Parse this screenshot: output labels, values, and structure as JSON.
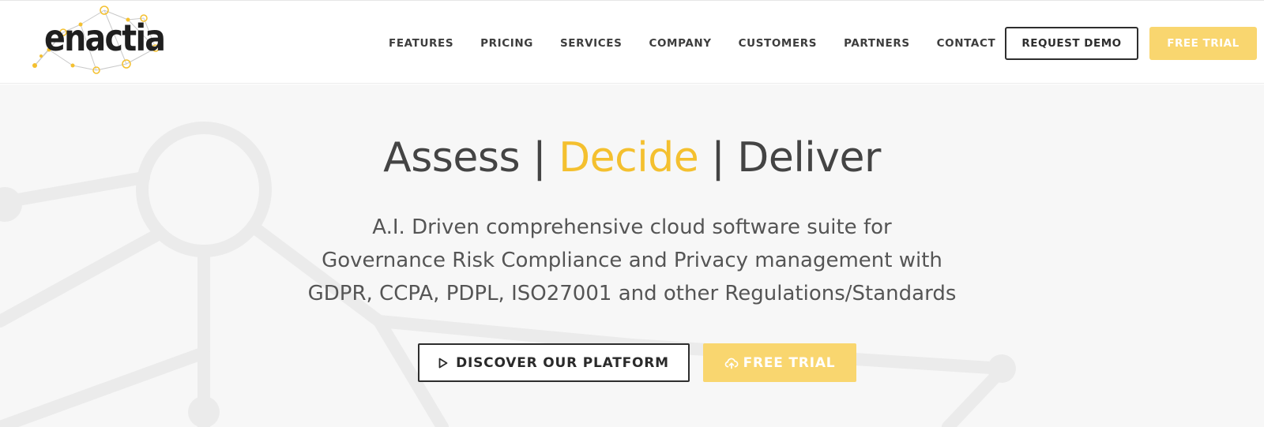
{
  "header": {
    "logo_text": "enactia",
    "nav": [
      {
        "label": "FEATURES"
      },
      {
        "label": "PRICING"
      },
      {
        "label": "SERVICES"
      },
      {
        "label": "COMPANY"
      },
      {
        "label": "CUSTOMERS"
      },
      {
        "label": "PARTNERS"
      },
      {
        "label": "CONTACT"
      }
    ],
    "request_demo_label": "REQUEST DEMO",
    "free_trial_label": "FREE TRIAL"
  },
  "hero": {
    "headline": {
      "part1": "Assess | ",
      "accent": "Decide",
      "part2": " | Deliver"
    },
    "subtitle": [
      "A.I. Driven comprehensive cloud software suite for",
      "Governance Risk Compliance and Privacy management with",
      "GDPR, CCPA, PDPL, ISO27001 and other Regulations/Standards"
    ],
    "discover_label": "DISCOVER OUR PLATFORM",
    "free_trial_label": "FREE TRIAL"
  },
  "icons": {
    "discover": "play-icon",
    "free_trial": "cloud-upload-icon"
  },
  "colors": {
    "accent": "#f4c02f",
    "button_yellow": "#f9d66f",
    "text_dark": "#444444",
    "hero_background": "#f7f7f7"
  }
}
